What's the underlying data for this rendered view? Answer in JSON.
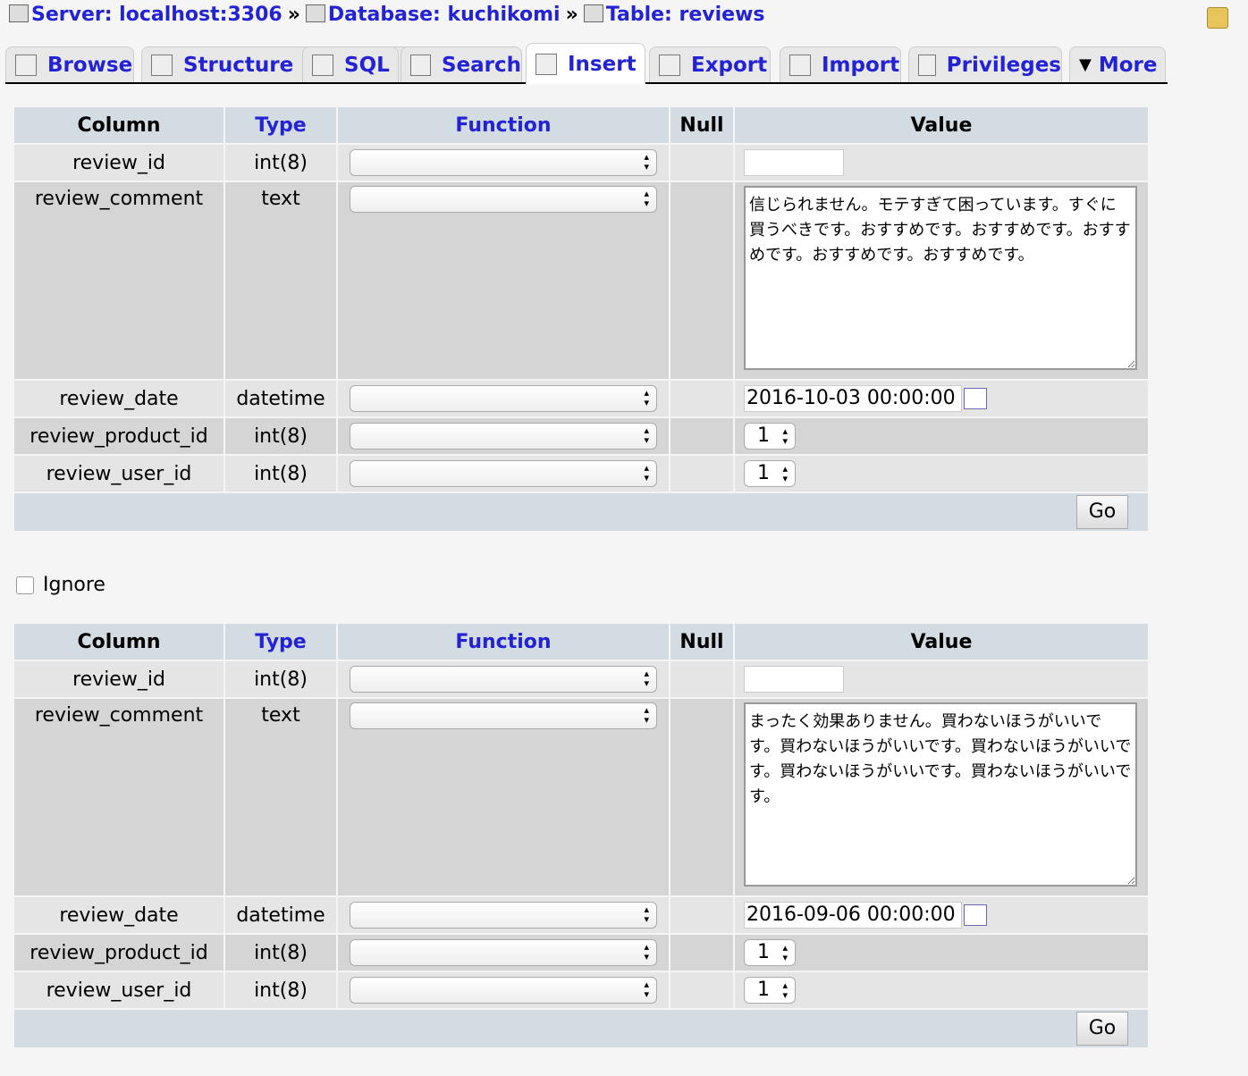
{
  "breadcrumb": {
    "server": "Server: localhost:3306",
    "database": "Database: kuchikomi",
    "table": "Table: reviews",
    "separator": "»"
  },
  "tabs": [
    {
      "label": "Browse",
      "icon": "browse-icon"
    },
    {
      "label": "Structure",
      "icon": "structure-icon"
    },
    {
      "label": "SQL",
      "icon": "sql-icon"
    },
    {
      "label": "Search",
      "icon": "search-icon"
    },
    {
      "label": "Insert",
      "icon": "insert-icon",
      "active": true
    },
    {
      "label": "Export",
      "icon": "export-icon"
    },
    {
      "label": "Import",
      "icon": "import-icon"
    },
    {
      "label": "Privileges",
      "icon": "privileges-icon"
    },
    {
      "label": "More",
      "icon": "chevron-down-icon"
    }
  ],
  "headers": {
    "column": "Column",
    "type": "Type",
    "function": "Function",
    "null": "Null",
    "value": "Value"
  },
  "go_label": "Go",
  "ignore_label": "Ignore",
  "forms": [
    {
      "rows": [
        {
          "column": "review_id",
          "type": "int(8)",
          "kind": "text",
          "value": ""
        },
        {
          "column": "review_comment",
          "type": "text",
          "kind": "textarea",
          "value": "信じられません。モテすぎて困っています。すぐに買うべきです。おすすめです。おすすめです。おすすめです。おすすめです。おすすめです。"
        },
        {
          "column": "review_date",
          "type": "datetime",
          "kind": "datetime",
          "value": "2016-10-03 00:00:00"
        },
        {
          "column": "review_product_id",
          "type": "int(8)",
          "kind": "number",
          "value": "1"
        },
        {
          "column": "review_user_id",
          "type": "int(8)",
          "kind": "number",
          "value": "1"
        }
      ]
    },
    {
      "rows": [
        {
          "column": "review_id",
          "type": "int(8)",
          "kind": "text",
          "value": ""
        },
        {
          "column": "review_comment",
          "type": "text",
          "kind": "textarea",
          "value": "まったく効果ありません。買わないほうがいいです。買わないほうがいいです。買わないほうがいいです。買わないほうがいいです。買わないほうがいいです。"
        },
        {
          "column": "review_date",
          "type": "datetime",
          "kind": "datetime",
          "value": "2016-09-06 00:00:00"
        },
        {
          "column": "review_product_id",
          "type": "int(8)",
          "kind": "number",
          "value": "1"
        },
        {
          "column": "review_user_id",
          "type": "int(8)",
          "kind": "number",
          "value": "1"
        }
      ]
    }
  ]
}
